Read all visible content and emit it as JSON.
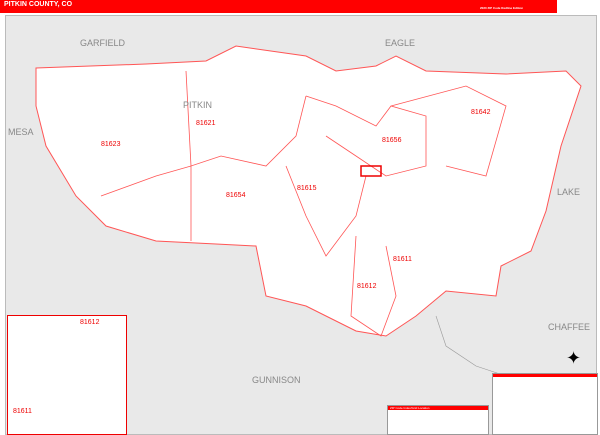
{
  "header": {
    "title": "PITKIN COUNTY, CO",
    "subtitle": "2020 ZIP Code Redline Edition",
    "brand_color": "#ff0000"
  },
  "counties": [
    "GARFIELD",
    "EAGLE",
    "MESA",
    "PITKIN",
    "LAKE",
    "CHAFFEE",
    "GUNNISON"
  ],
  "zips": [
    "81623",
    "81621",
    "81654",
    "81615",
    "81656",
    "81642",
    "81611",
    "81612"
  ],
  "inset": {
    "zips": [
      "81612",
      "81611"
    ]
  },
  "index": {
    "title": "ZIP Code Index/Grid Location"
  },
  "icons": {
    "compass": "compass-rose-icon"
  }
}
